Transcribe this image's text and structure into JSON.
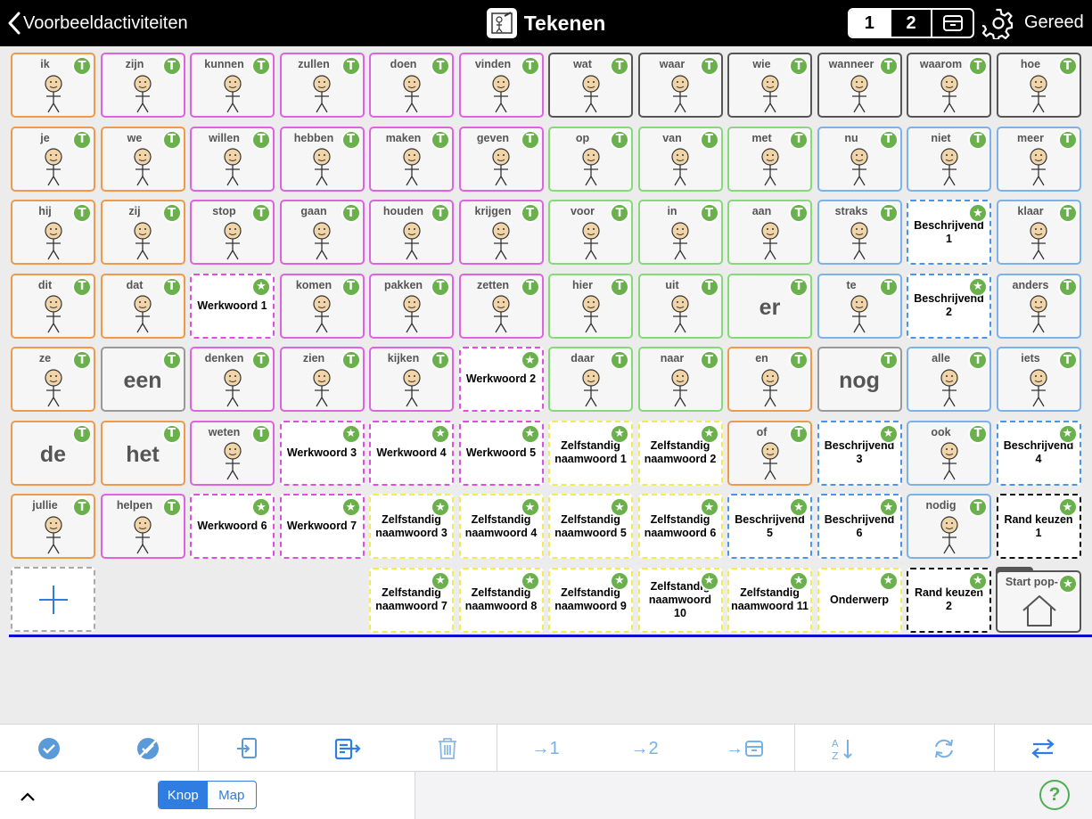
{
  "header": {
    "back_label": "Voorbeeldactiviteiten",
    "title": "Tekenen",
    "pages": [
      "1",
      "2"
    ],
    "active_page": "1",
    "done_label": "Gereed"
  },
  "badge_t": "T",
  "colors": {
    "orange": "#ee9a4d",
    "magenta": "#de63de",
    "dark": "#555555",
    "green": "#86d97a",
    "blue": "#7db1ea",
    "yellow_dashed": "#f1ec55",
    "blue_dashed": "#4b94e6",
    "black_dashed": "#111111",
    "badge_green": "#6ab04c"
  },
  "rows": [
    [
      {
        "label": "ik",
        "style": "orange",
        "badge": "T",
        "icon": "person-self-icon"
      },
      {
        "label": "zijn",
        "style": "magenta",
        "badge": "T",
        "icon": "equals-icon"
      },
      {
        "label": "kunnen",
        "style": "magenta",
        "badge": "T",
        "icon": "person-flex-icon"
      },
      {
        "label": "zullen",
        "style": "magenta",
        "badge": "T",
        "icon": "future-arrow-icon"
      },
      {
        "label": "doen",
        "style": "magenta",
        "badge": "T",
        "icon": "person-doing-icon"
      },
      {
        "label": "vinden",
        "style": "magenta",
        "badge": "T",
        "icon": "person-finding-icon"
      },
      {
        "label": "wat",
        "style": "dark",
        "badge": "T",
        "icon": "question-person-icon"
      },
      {
        "label": "waar",
        "style": "dark",
        "badge": "T",
        "icon": "question-person-icon"
      },
      {
        "label": "wie",
        "style": "dark",
        "badge": "T",
        "icon": "question-face-icon"
      },
      {
        "label": "wanneer",
        "style": "dark",
        "badge": "T",
        "icon": "question-clock-icon"
      },
      {
        "label": "waarom",
        "style": "dark",
        "badge": "T",
        "icon": "question-thinking-icon"
      },
      {
        "label": "hoe",
        "style": "dark",
        "badge": "T",
        "icon": "question-triangle-icon"
      }
    ],
    [
      {
        "label": "je",
        "style": "orange",
        "badge": "T",
        "icon": "two-persons-icon"
      },
      {
        "label": "we",
        "style": "orange",
        "badge": "T",
        "icon": "two-faces-icon"
      },
      {
        "label": "willen",
        "style": "magenta",
        "badge": "T",
        "icon": "person-wanting-icon"
      },
      {
        "label": "hebben",
        "style": "magenta",
        "badge": "T",
        "icon": "person-holding-icon"
      },
      {
        "label": "maken",
        "style": "magenta",
        "badge": "T",
        "icon": "person-making-icon"
      },
      {
        "label": "geven",
        "style": "magenta",
        "badge": "T",
        "icon": "persons-giving-icon"
      },
      {
        "label": "op",
        "style": "green",
        "badge": "T",
        "icon": "arrow-on-icon"
      },
      {
        "label": "van",
        "style": "green",
        "badge": "T",
        "icon": "arrow-from-icon"
      },
      {
        "label": "met",
        "style": "green",
        "badge": "T",
        "icon": "squares-with-icon"
      },
      {
        "label": "nu",
        "style": "blue",
        "badge": "T",
        "icon": "person-clock-icon"
      },
      {
        "label": "niet",
        "style": "blue",
        "badge": "T",
        "icon": "cross-icon"
      },
      {
        "label": "meer",
        "style": "blue",
        "badge": "T",
        "icon": "squares-more-icon"
      }
    ],
    [
      {
        "label": "hij",
        "style": "orange",
        "badge": "T",
        "icon": "boy-face-icon"
      },
      {
        "label": "zij",
        "style": "orange",
        "badge": "T",
        "icon": "girl-face-icon"
      },
      {
        "label": "stop",
        "style": "magenta",
        "badge": "T",
        "icon": "stop-sign-icon"
      },
      {
        "label": "gaan",
        "style": "magenta",
        "badge": "T",
        "icon": "green-arrow-icon"
      },
      {
        "label": "houden",
        "style": "magenta",
        "badge": "T",
        "icon": "person-keep-icon"
      },
      {
        "label": "krijgen",
        "style": "magenta",
        "badge": "T",
        "icon": "person-receive-icon"
      },
      {
        "label": "voor",
        "style": "green",
        "badge": "T",
        "icon": "tag-icon"
      },
      {
        "label": "in",
        "style": "green",
        "badge": "T",
        "icon": "arrow-into-icon"
      },
      {
        "label": "aan",
        "style": "green",
        "badge": "T",
        "icon": "arrow-right-icon"
      },
      {
        "label": "straks",
        "style": "blue",
        "badge": "T",
        "icon": "clock-later-icon"
      },
      {
        "placeholder": "Beschrijvend 1",
        "style": "dblue",
        "badge": "star"
      },
      {
        "label": "klaar",
        "style": "blue",
        "badge": "T",
        "icon": "person-ready-icon"
      }
    ],
    [
      {
        "label": "dit",
        "style": "orange",
        "badge": "T",
        "icon": "point-this-icon"
      },
      {
        "label": "dat",
        "style": "orange",
        "badge": "T",
        "icon": "point-that-icon"
      },
      {
        "placeholder": "Werkwoord 1",
        "style": "dmag",
        "badge": "star"
      },
      {
        "label": "komen",
        "style": "magenta",
        "badge": "T",
        "icon": "person-come-icon"
      },
      {
        "label": "pakken",
        "style": "magenta",
        "badge": "T",
        "icon": "hand-take-icon"
      },
      {
        "label": "zetten",
        "style": "magenta",
        "badge": "T",
        "icon": "person-put-icon"
      },
      {
        "label": "hier",
        "style": "green",
        "badge": "T",
        "icon": "point-here-icon"
      },
      {
        "label": "uit",
        "style": "green",
        "badge": "T",
        "icon": "arrow-out-icon"
      },
      {
        "big": "er",
        "style": "green",
        "badge": "T"
      },
      {
        "label": "te",
        "style": "blue",
        "badge": "T",
        "icon": "squares-to-icon"
      },
      {
        "placeholder": "Beschrijvend 2",
        "style": "dblue",
        "badge": "star"
      },
      {
        "label": "anders",
        "style": "blue",
        "badge": "T",
        "icon": "squares-other-icon"
      }
    ],
    [
      {
        "label": "ze",
        "style": "orange",
        "badge": "T",
        "icon": "group-icon"
      },
      {
        "big": "een",
        "style": "grey",
        "badge": "T"
      },
      {
        "label": "denken",
        "style": "magenta",
        "badge": "T",
        "icon": "person-think-icon"
      },
      {
        "label": "zien",
        "style": "magenta",
        "badge": "T",
        "icon": "eye-look-icon"
      },
      {
        "label": "kijken",
        "style": "magenta",
        "badge": "T",
        "icon": "person-look-icon"
      },
      {
        "placeholder": "Werkwoord 2",
        "style": "dmag",
        "badge": "star"
      },
      {
        "label": "daar",
        "style": "green",
        "badge": "T",
        "icon": "point-there-icon"
      },
      {
        "label": "naar",
        "style": "green",
        "badge": "T",
        "icon": "arrow-towards-icon"
      },
      {
        "label": "en",
        "style": "orange",
        "badge": "T",
        "icon": "plus-icon"
      },
      {
        "big": "nog",
        "style": "grey",
        "badge": "T"
      },
      {
        "label": "alle",
        "style": "blue",
        "badge": "T",
        "icon": "squares-all-icon"
      },
      {
        "label": "iets",
        "style": "blue",
        "badge": "T",
        "icon": "question-something-icon"
      }
    ],
    [
      {
        "big": "de",
        "style": "orange",
        "badge": "T"
      },
      {
        "big": "het",
        "style": "orange",
        "badge": "T"
      },
      {
        "label": "weten",
        "style": "magenta",
        "badge": "T",
        "icon": "person-desk-icon"
      },
      {
        "placeholder": "Werkwoord 3",
        "style": "dmag",
        "badge": "star"
      },
      {
        "placeholder": "Werkwoord 4",
        "style": "dmag",
        "badge": "star"
      },
      {
        "placeholder": "Werkwoord 5",
        "style": "dmag",
        "badge": "star"
      },
      {
        "placeholder": "Zelfstandig naamwoord 1",
        "style": "dyel",
        "badge": "star"
      },
      {
        "placeholder": "Zelfstandig naamwoord 2",
        "style": "dyel",
        "badge": "star"
      },
      {
        "label": "of",
        "style": "orange",
        "badge": "T",
        "icon": "person-or-icon"
      },
      {
        "placeholder": "Beschrijvend 3",
        "style": "dblue",
        "badge": "star"
      },
      {
        "label": "ook",
        "style": "blue",
        "badge": "T",
        "icon": "squares-also-icon"
      },
      {
        "placeholder": "Beschrijvend 4",
        "style": "dblue",
        "badge": "star"
      }
    ],
    [
      {
        "label": "jullie",
        "style": "orange",
        "badge": "T",
        "icon": "persons-you-icon"
      },
      {
        "label": "helpen",
        "style": "magenta",
        "badge": "T",
        "icon": "person-help-icon"
      },
      {
        "placeholder": "Werkwoord 6",
        "style": "dmag",
        "badge": "star"
      },
      {
        "placeholder": "Werkwoord 7",
        "style": "dmag",
        "badge": "star"
      },
      {
        "placeholder": "Zelfstandig naamwoord 3",
        "style": "dyel",
        "badge": "star"
      },
      {
        "placeholder": "Zelfstandig naamwoord 4",
        "style": "dyel",
        "badge": "star"
      },
      {
        "placeholder": "Zelfstandig naamwoord 5",
        "style": "dyel",
        "badge": "star"
      },
      {
        "placeholder": "Zelfstandig naamwoord 6",
        "style": "dyel",
        "badge": "star"
      },
      {
        "placeholder": "Beschrijvend 5",
        "style": "dblue",
        "badge": "star"
      },
      {
        "placeholder": "Beschrijvend 6",
        "style": "dblue",
        "badge": "star"
      },
      {
        "label": "nodig",
        "style": "blue",
        "badge": "T",
        "icon": "hand-need-icon"
      },
      {
        "placeholder": "Rand keuzen 1",
        "style": "dblack",
        "badge": "star"
      }
    ],
    [
      null,
      null,
      null,
      null,
      {
        "placeholder": "Zelfstandig naamwoord 7",
        "style": "dyel",
        "badge": "star"
      },
      {
        "placeholder": "Zelfstandig naamwoord 8",
        "style": "dyel",
        "badge": "star"
      },
      {
        "placeholder": "Zelfstandig naamwoord 9",
        "style": "dyel",
        "badge": "star"
      },
      {
        "placeholder": "Zelfstandig naamwoord 10",
        "style": "dyel",
        "badge": "star"
      },
      {
        "placeholder": "Zelfstandig naamwoord 11",
        "style": "dyel",
        "badge": "star"
      },
      {
        "placeholder": "Onderwerp",
        "style": "dyel",
        "badge": "star"
      },
      {
        "placeholder": "Rand keuzen 2",
        "style": "dblack",
        "badge": "star"
      },
      null
    ]
  ],
  "popup_cell": {
    "label": "Start pop-up",
    "icon": "home-icon"
  },
  "toolbar": {
    "goto_page1": "→1",
    "goto_page2": "→2"
  },
  "bottom": {
    "mode_options": [
      "Knop",
      "Map"
    ],
    "mode_selected": "Knop",
    "help_label": "?"
  }
}
